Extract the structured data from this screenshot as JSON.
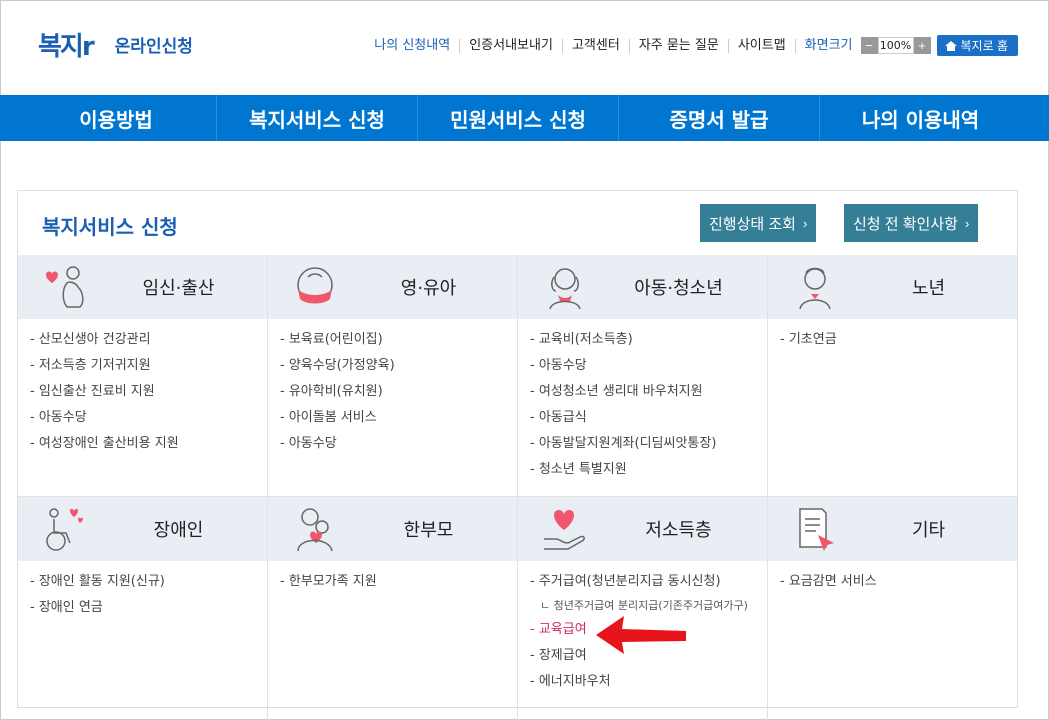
{
  "header": {
    "logo_text": "복지r",
    "logo_sub": "온라인신청",
    "util_links": [
      "나의 신청내역",
      "인증서내보내기",
      "고객센터",
      "자주 묻는 질문",
      "사이트맵"
    ],
    "zoom_label": "화면크기",
    "zoom_value": "100%",
    "zoom_minus": "−",
    "zoom_plus": "+",
    "home_label": "복지로 홈"
  },
  "nav": [
    "이용방법",
    "복지서비스 신청",
    "민원서비스 신청",
    "증명서 발급",
    "나의 이용내역"
  ],
  "panel": {
    "title": "복지서비스 신청",
    "btn_status": "진행상태 조회",
    "btn_check": "신청 전 확인사항",
    "chevron": "›"
  },
  "categories": [
    {
      "title": "임신·출산",
      "icon": "pregnancy-icon",
      "items": [
        "- 산모신생아 건강관리",
        "- 저소득층 기저귀지원",
        "- 임신출산 진료비 지원",
        "- 아동수당",
        "- 여성장애인 출산비용 지원"
      ]
    },
    {
      "title": "영·유아",
      "icon": "baby-icon",
      "items": [
        "- 보육료(어린이집)",
        "- 양육수당(가정양육)",
        "- 유아학비(유치원)",
        "- 아이돌봄 서비스",
        "- 아동수당"
      ]
    },
    {
      "title": "아동·청소년",
      "icon": "child-icon",
      "items": [
        "- 교육비(저소득층)",
        "- 아동수당",
        "- 여성청소년 생리대 바우처지원",
        "- 아동급식",
        "- 아동발달지원계좌(디딤씨앗통장)",
        "- 청소년 특별지원"
      ]
    },
    {
      "title": "노년",
      "icon": "elderly-icon",
      "items": [
        "- 기초연금"
      ]
    },
    {
      "title": "장애인",
      "icon": "wheelchair-icon",
      "items": [
        "- 장애인 활동 지원(신규)",
        "- 장애인 연금"
      ]
    },
    {
      "title": "한부모",
      "icon": "single-parent-icon",
      "items": [
        "- 한부모가족 지원"
      ]
    },
    {
      "title": "저소득층",
      "icon": "heart-hand-icon",
      "items": [
        "- 주거급여(청년분리지급 동시신청)"
      ],
      "sub_item": "ㄴ 청년주거급여 분리지급(기존주거급여가구)",
      "highlight_item": "- 교육급여",
      "items_after": [
        "- 장제급여",
        "- 에너지바우처"
      ]
    },
    {
      "title": "기타",
      "icon": "document-icon",
      "items": [
        "- 요금감면 서비스"
      ]
    }
  ]
}
